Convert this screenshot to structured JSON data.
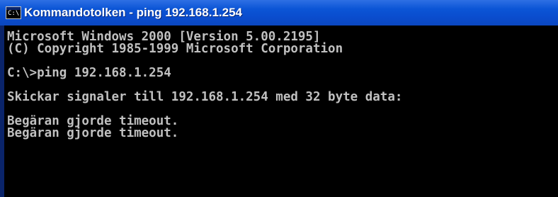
{
  "window": {
    "title": "Kommandotolken - ping 192.168.1.254",
    "icon": "cmd-icon",
    "icon_glyph": "C:\\"
  },
  "console": {
    "lines": [
      "Microsoft Windows 2000 [Version 5.00.2195]",
      "(C) Copyright 1985-1999 Microsoft Corporation",
      "",
      "C:\\>ping 192.168.1.254",
      "",
      "Skickar signaler till 192.168.1.254 med 32 byte data:",
      "",
      "Begäran gjorde timeout.",
      "Begäran gjorde timeout."
    ]
  },
  "colors": {
    "titlebar": "#0b55d6",
    "console_background": "#000000",
    "console_text": "#c0c0c0"
  }
}
